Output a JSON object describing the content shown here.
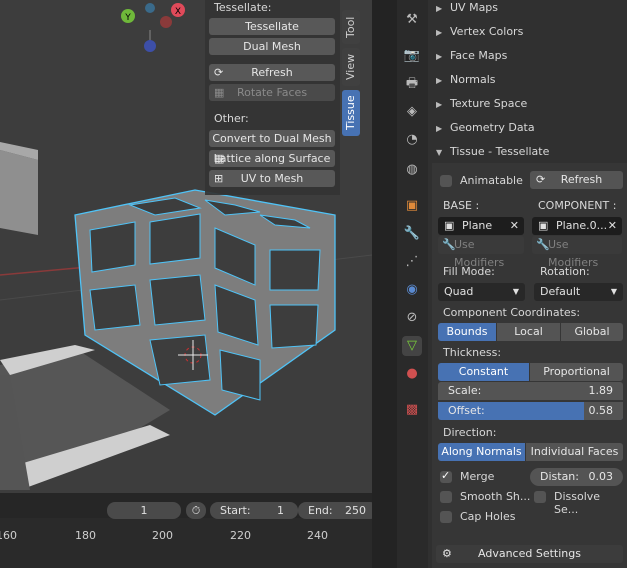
{
  "tool_panel": {
    "tessellate_heading": "Tessellate:",
    "tessellate_btn": "Tessellate",
    "dual_mesh_btn": "Dual Mesh",
    "refresh_btn": "Refresh",
    "rotate_faces_btn": "Rotate Faces",
    "other_heading": "Other:",
    "convert_btn": "Convert to Dual Mesh",
    "lattice_btn": "Lattice along Surface",
    "uv_btn": "UV to Mesh"
  },
  "vtabs": [
    "Tool",
    "View",
    "Tissue"
  ],
  "gizmo": {
    "y": "Y",
    "x": "X"
  },
  "sections": [
    "UV Maps",
    "Vertex Colors",
    "Face Maps",
    "Normals",
    "Texture Space",
    "Geometry Data",
    "Tissue - Tessellate"
  ],
  "tissue": {
    "animatable": "Animatable",
    "refresh": "Refresh",
    "base_label": "BASE :",
    "component_label": "COMPONENT :",
    "base_object": "Plane",
    "component_object": "Plane.0...",
    "use_modifiers": "Use Modifiers",
    "fill_mode_label": "Fill Mode:",
    "fill_mode_value": "Quad",
    "rotation_label": "Rotation:",
    "rotation_value": "Default",
    "coords_label": "Component Coordinates:",
    "coords": [
      "Bounds",
      "Local",
      "Global"
    ],
    "thickness_label": "Thickness:",
    "thickness_modes": [
      "Constant",
      "Proportional"
    ],
    "scale_label": "Scale:",
    "scale_value": "1.89",
    "offset_label": "Offset:",
    "offset_value": "0.58",
    "direction_label": "Direction:",
    "directions": [
      "Along Normals",
      "Individual Faces"
    ],
    "merge": "Merge",
    "distance_label": "Distan:",
    "distance_value": "0.03",
    "smooth_shading": "Smooth Sh...",
    "dissolve": "Dissolve Se...",
    "cap_holes": "Cap Holes",
    "advanced": "Advanced Settings"
  },
  "timeline": {
    "current_frame": "1",
    "start_label": "Start:",
    "start_value": "1",
    "end_label": "End:",
    "end_value": "250",
    "ticks": [
      "160",
      "180",
      "200",
      "220",
      "240"
    ]
  },
  "colors": {
    "accent": "#4772b3",
    "wire": "#4fc3f7",
    "x_axis": "#e04a5a",
    "y_axis": "#6fb83a",
    "z_axis": "#3d6fcf"
  }
}
